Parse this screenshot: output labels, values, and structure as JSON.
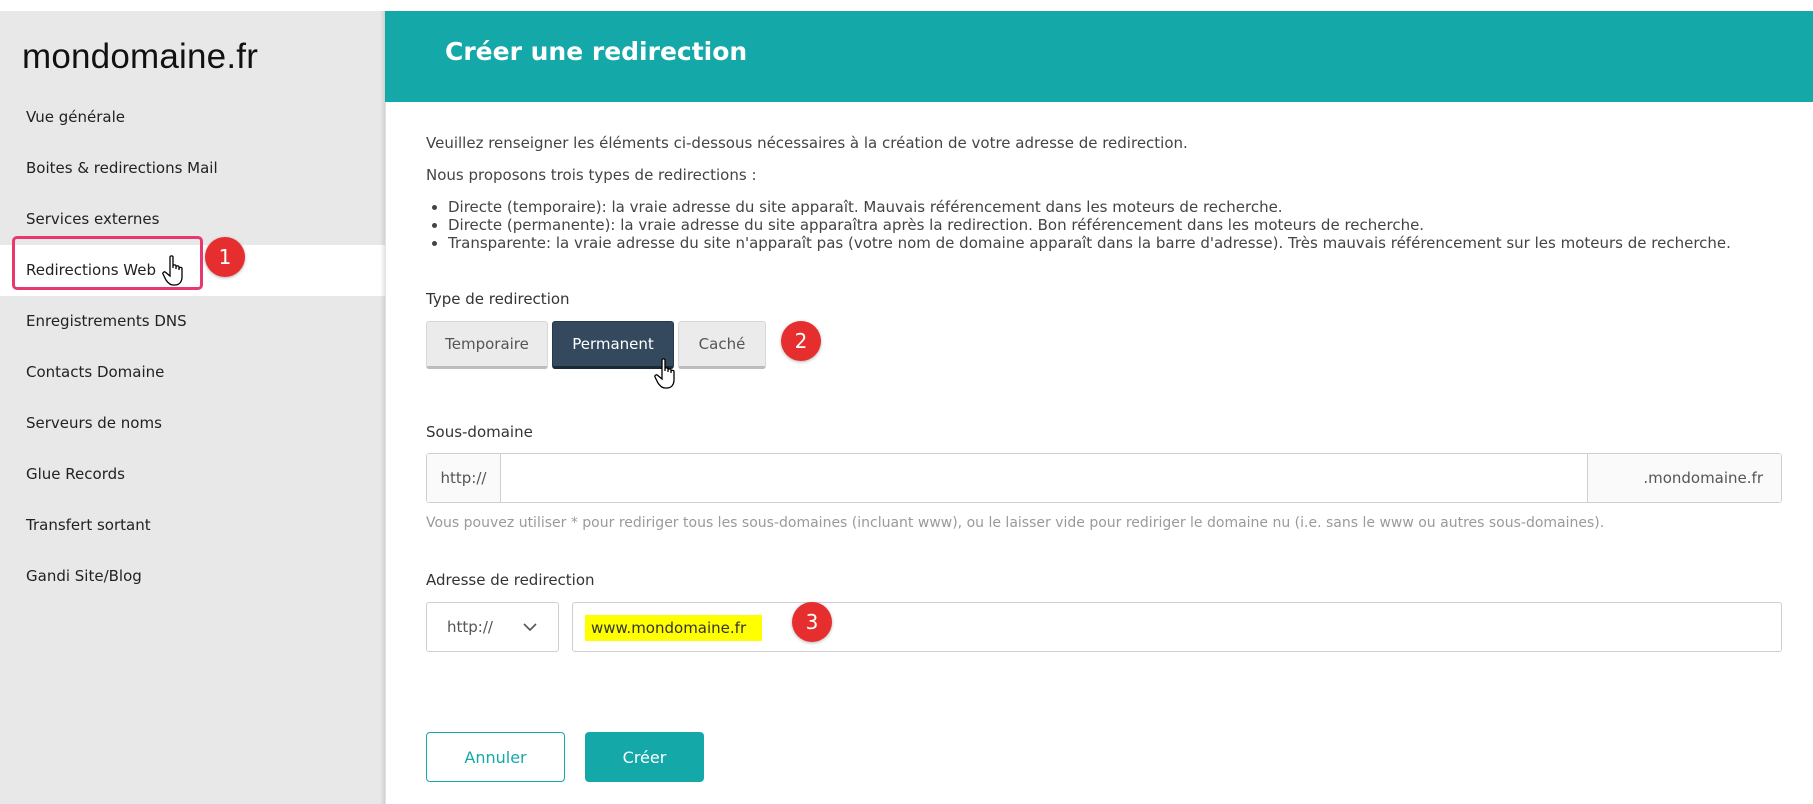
{
  "brand": "mondomaine.fr",
  "sidebar": {
    "items": [
      {
        "label": "Vue générale"
      },
      {
        "label": "Boites & redirections Mail"
      },
      {
        "label": "Services externes"
      },
      {
        "label": "Redirections Web"
      },
      {
        "label": "Enregistrements DNS"
      },
      {
        "label": "Contacts Domaine"
      },
      {
        "label": "Serveurs de noms"
      },
      {
        "label": "Glue Records"
      },
      {
        "label": "Transfert sortant"
      },
      {
        "label": "Gandi Site/Blog"
      }
    ],
    "active_index": 3
  },
  "header": {
    "title": "Créer une redirection"
  },
  "intro": {
    "line1": "Veuillez renseigner les éléments ci-dessous nécessaires à la création de votre adresse de redirection.",
    "line2": "Nous proposons trois types de redirections :",
    "bullets": [
      "Directe (temporaire): la vraie adresse du site apparaît. Mauvais référencement dans les moteurs de recherche.",
      "Directe (permanente): la vraie adresse du site apparaîtra après la redirection. Bon référencement dans les moteurs de recherche.",
      "Transparente: la vraie adresse du site n'apparaît pas (votre nom de domaine apparaît dans la barre d'adresse). Très mauvais référencement sur les moteurs de recherche."
    ]
  },
  "redirect_type": {
    "label": "Type de redirection",
    "options": [
      "Temporaire",
      "Permanent",
      "Caché"
    ],
    "selected": "Permanent"
  },
  "subdomain": {
    "label": "Sous-domaine",
    "prefix": "http://",
    "value": "",
    "suffix": ".mondomaine.fr",
    "help": "Vous pouvez utiliser * pour rediriger tous les sous-domaines (incluant www), ou le laisser vide pour rediriger le domaine nu (i.e. sans le www ou autres sous-domaines)."
  },
  "redirect_address": {
    "label": "Adresse de redirection",
    "protocol": "http://",
    "value": "www.mondomaine.fr"
  },
  "actions": {
    "cancel": "Annuler",
    "create": "Créer"
  },
  "annotations": [
    "1",
    "2",
    "3"
  ],
  "colors": {
    "accent": "#15a8a8",
    "selected_button": "#34495e",
    "badge": "#e62e2e",
    "highlight_box": "#e8386d",
    "text_highlight": "#ffff00"
  }
}
